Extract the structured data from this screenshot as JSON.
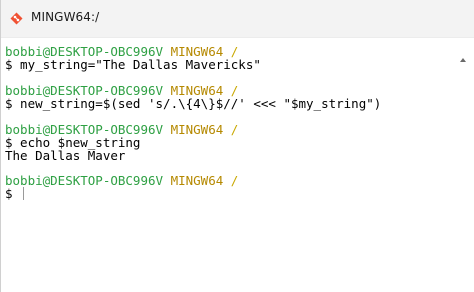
{
  "window": {
    "title": "MINGW64:/",
    "icon": "git-bash-icon"
  },
  "terminal": {
    "lines": [
      {
        "type": "prompt",
        "user": "bobbi@DESKTOP-OBC996V",
        "host": "MINGW64",
        "path": "/"
      },
      {
        "type": "output",
        "text": "$ my_string=\"The Dallas Mavericks\""
      },
      {
        "type": "prompt",
        "user": "bobbi@DESKTOP-OBC996V",
        "host": "MINGW64",
        "path": "/"
      },
      {
        "type": "output",
        "text": "$ new_string=$(sed 's/.\\{4\\}$//' <<< \"$my_string\")"
      },
      {
        "type": "prompt",
        "user": "bobbi@DESKTOP-OBC996V",
        "host": "MINGW64",
        "path": "/"
      },
      {
        "type": "output",
        "text": "$ echo $new_string"
      },
      {
        "type": "output",
        "text": "The Dallas Maver"
      },
      {
        "type": "prompt",
        "user": "bobbi@DESKTOP-OBC996V",
        "host": "MINGW64",
        "path": "/"
      },
      {
        "type": "output",
        "text": "$ "
      }
    ]
  },
  "colors": {
    "user": "#2ea043",
    "host": "#b58900",
    "path": "#c9a800",
    "background": "#ffffff",
    "titlebar": "#f3f3f3"
  }
}
